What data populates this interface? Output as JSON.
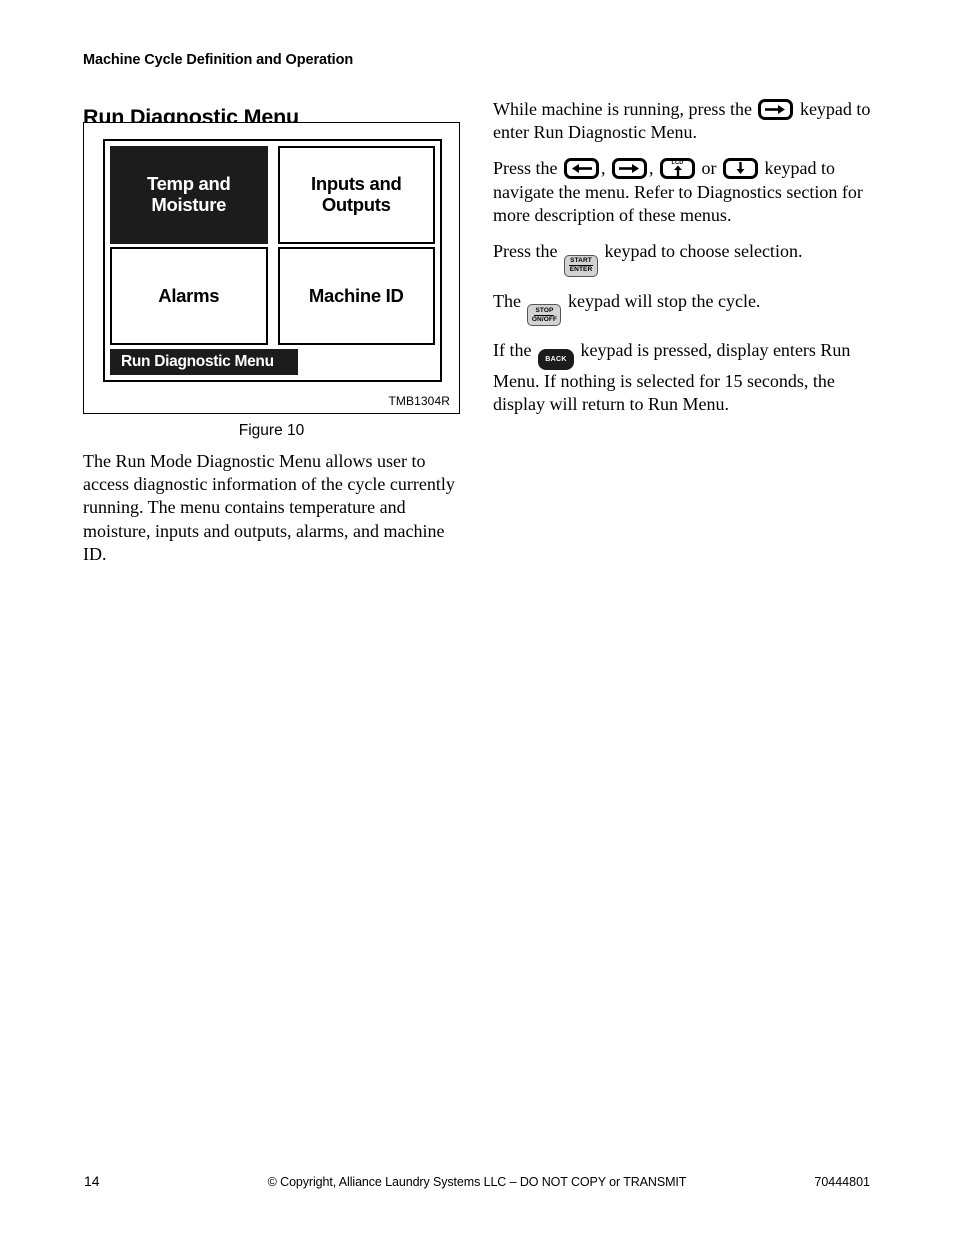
{
  "page": {
    "running_head": "Machine Cycle Definition and Operation",
    "section_title": "Run Diagnostic Menu"
  },
  "figure": {
    "caption": "Figure 10",
    "code": "TMB1304R",
    "screen": {
      "tiles": [
        {
          "label": "Temp and Moisture",
          "selected": true
        },
        {
          "label": "Inputs and Outputs",
          "selected": false
        },
        {
          "label": "Alarms",
          "selected": false
        },
        {
          "label": "Machine ID",
          "selected": false
        }
      ],
      "status_bar": "Run Diagnostic Menu"
    }
  },
  "left_body": {
    "paragraph": "The Run Mode Diagnostic Menu allows user to access diagnostic information of the cycle currently running. The menu contains temperature and moisture, inputs and outputs, alarms, and machine ID."
  },
  "right_body": {
    "p1_a": "While machine is running, press the",
    "p1_b": "keypad to enter Run Diagnostic Menu.",
    "p2_a": "Press the",
    "p2_comma1": ",",
    "p2_comma2": ",",
    "p2_or": "or",
    "p2_b": "keypad to navigate the menu. Refer to Diagnostics section for more description of these menus.",
    "p3_a": "Press the",
    "p3_b": "keypad to choose selection.",
    "p4_a": "The",
    "p4_b": "keypad will stop the cycle.",
    "p5_a": "If the",
    "p5_b": "keypad is pressed, display enters Run Menu. If nothing is selected for 15 seconds, the display will return to Run Menu."
  },
  "keypads": {
    "right_arrow": "right-arrow-keypad",
    "left_arrow": "left-arrow-keypad",
    "lcd_up": "LCD",
    "down_arrow": "down-arrow-keypad",
    "start_enter_line1": "START",
    "start_enter_line2": "ENTER",
    "stop_line1": "STOP",
    "stop_line2": "ON/OFF",
    "back": "BACK"
  },
  "footer": {
    "page_number": "14",
    "copyright": "© Copyright, Alliance Laundry Systems LLC – DO NOT COPY or TRANSMIT",
    "doc_number": "70444801"
  },
  "colors": {
    "screen_selected_bg": "#1c1c1c",
    "screen_bg": "#ffffff",
    "key_gray": "#d2d2d2",
    "ink": "#000000"
  }
}
